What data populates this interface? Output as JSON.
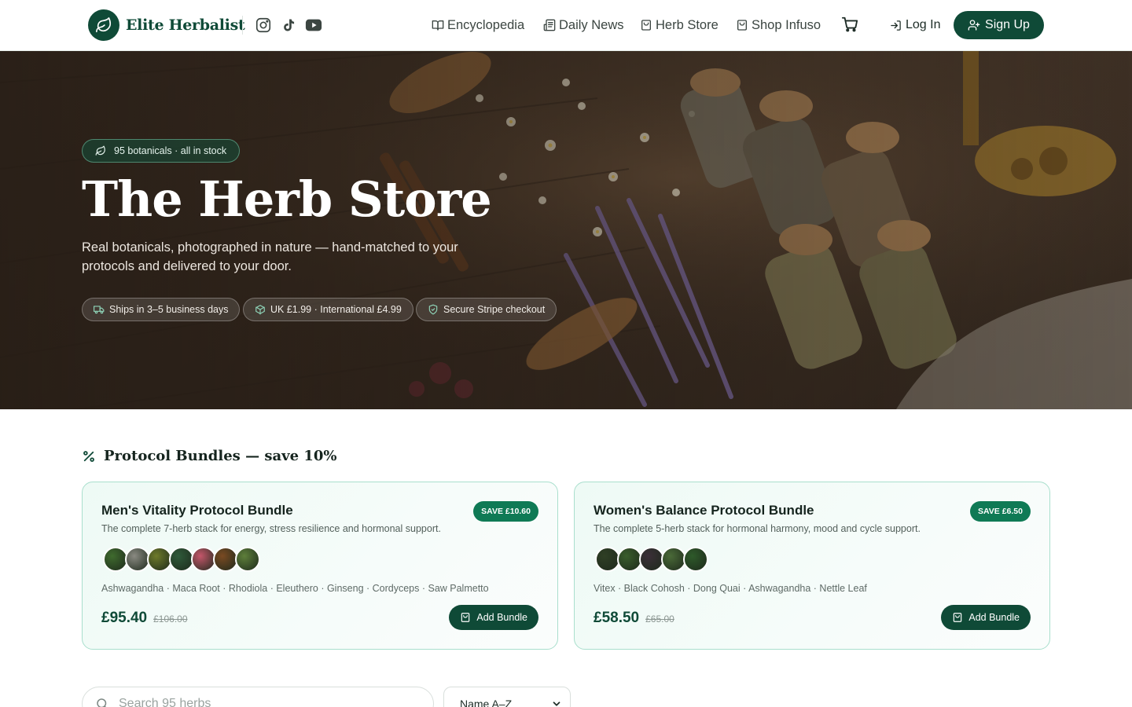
{
  "brand": {
    "name": "Elite Herbalist",
    "icon": "leaf-icon"
  },
  "social": [
    {
      "name": "instagram",
      "icon": "instagram-icon"
    },
    {
      "name": "tiktok",
      "icon": "tiktok-icon"
    },
    {
      "name": "youtube",
      "icon": "youtube-icon"
    }
  ],
  "nav": [
    {
      "label": "Encyclopedia",
      "icon": "book-icon"
    },
    {
      "label": "Daily News",
      "icon": "newspaper-icon"
    },
    {
      "label": "Herb Store",
      "icon": "shopping-bag-icon"
    },
    {
      "label": "Shop Infuso",
      "icon": "shopping-bag-icon"
    }
  ],
  "header": {
    "cart_icon": "cart-icon",
    "login_label": "Log In",
    "signup_label": "Sign Up"
  },
  "hero": {
    "badge": "95 botanicals · all in stock",
    "title": "The Herb Store",
    "subtitle": "Real botanicals, photographed in nature — hand-matched to your protocols and delivered to your door.",
    "chips": [
      {
        "label": "Ships in 3–5 business days",
        "icon": "truck-icon"
      },
      {
        "label": "UK £1.99 · International £4.99",
        "icon": "package-icon"
      },
      {
        "label": "Secure Stripe checkout",
        "icon": "shield-icon"
      }
    ]
  },
  "bundles_section": {
    "title": "Protocol Bundles — save 10%",
    "icon": "percent-icon",
    "bundles": [
      {
        "title": "Men's Vitality Protocol Bundle",
        "save": "SAVE £10.60",
        "description": "The complete 7-herb stack for energy, stress resilience and hormonal support.",
        "herbs": "Ashwagandha · Maca Root · Rhodiola · Eleuthero · Ginseng · Cordyceps · Saw Palmetto",
        "price": "£95.40",
        "old_price": "£106.00",
        "button": "Add Bundle",
        "thumb_colors": [
          "#3f6b2e",
          "#8a8a82",
          "#6e7a2a",
          "#2f5a3a",
          "#c4566a",
          "#7a4a22",
          "#5e7f3a"
        ]
      },
      {
        "title": "Women's Balance Protocol Bundle",
        "save": "SAVE £6.50",
        "description": "The complete 5-herb stack for hormonal harmony, mood and cycle support.",
        "herbs": "Vitex · Black Cohosh · Dong Quai · Ashwagandha · Nettle Leaf",
        "price": "£58.50",
        "old_price": "£65.00",
        "button": "Add Bundle",
        "thumb_colors": [
          "#2f3f25",
          "#3a5e2c",
          "#3b2f38",
          "#4a6a38",
          "#2e5a2a"
        ]
      }
    ]
  },
  "search": {
    "placeholder": "Search 95 herbs",
    "icon": "search-icon"
  },
  "sort": {
    "selected": "Name A–Z",
    "icon": "chevron-down-icon"
  }
}
